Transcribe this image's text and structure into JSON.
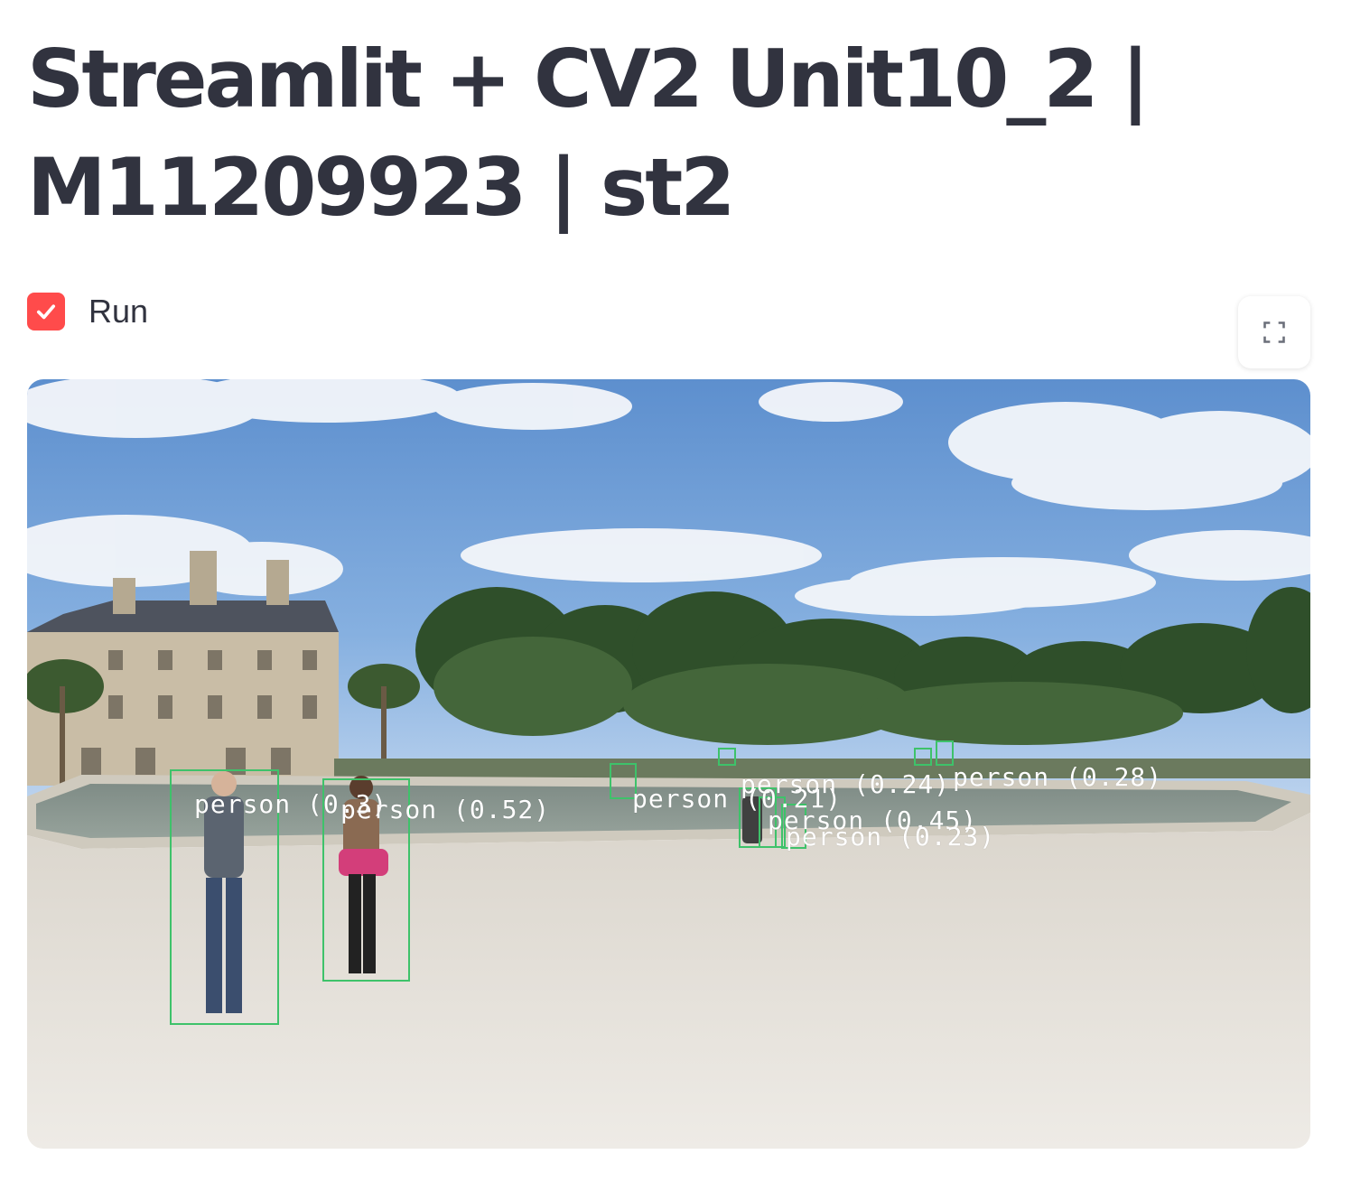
{
  "title_line1": "Streamlit + CV2 Unit10_2 |",
  "title_line2": "M11209923 | st2",
  "run_checkbox": {
    "label": "Run",
    "checked": true
  },
  "fullscreen_button": {
    "icon": "fullscreen-icon"
  },
  "accent_color": "#ff4b4b",
  "box_color": "#3ec26a",
  "detections": [
    {
      "label": "person (0.3)"
    },
    {
      "label": "person (0.52)"
    },
    {
      "label": "person (0.21)"
    },
    {
      "label": "person (0.24)"
    },
    {
      "label": "person (0.28)"
    },
    {
      "label": "person (0.45)"
    },
    {
      "label": "person (0.23)"
    }
  ]
}
